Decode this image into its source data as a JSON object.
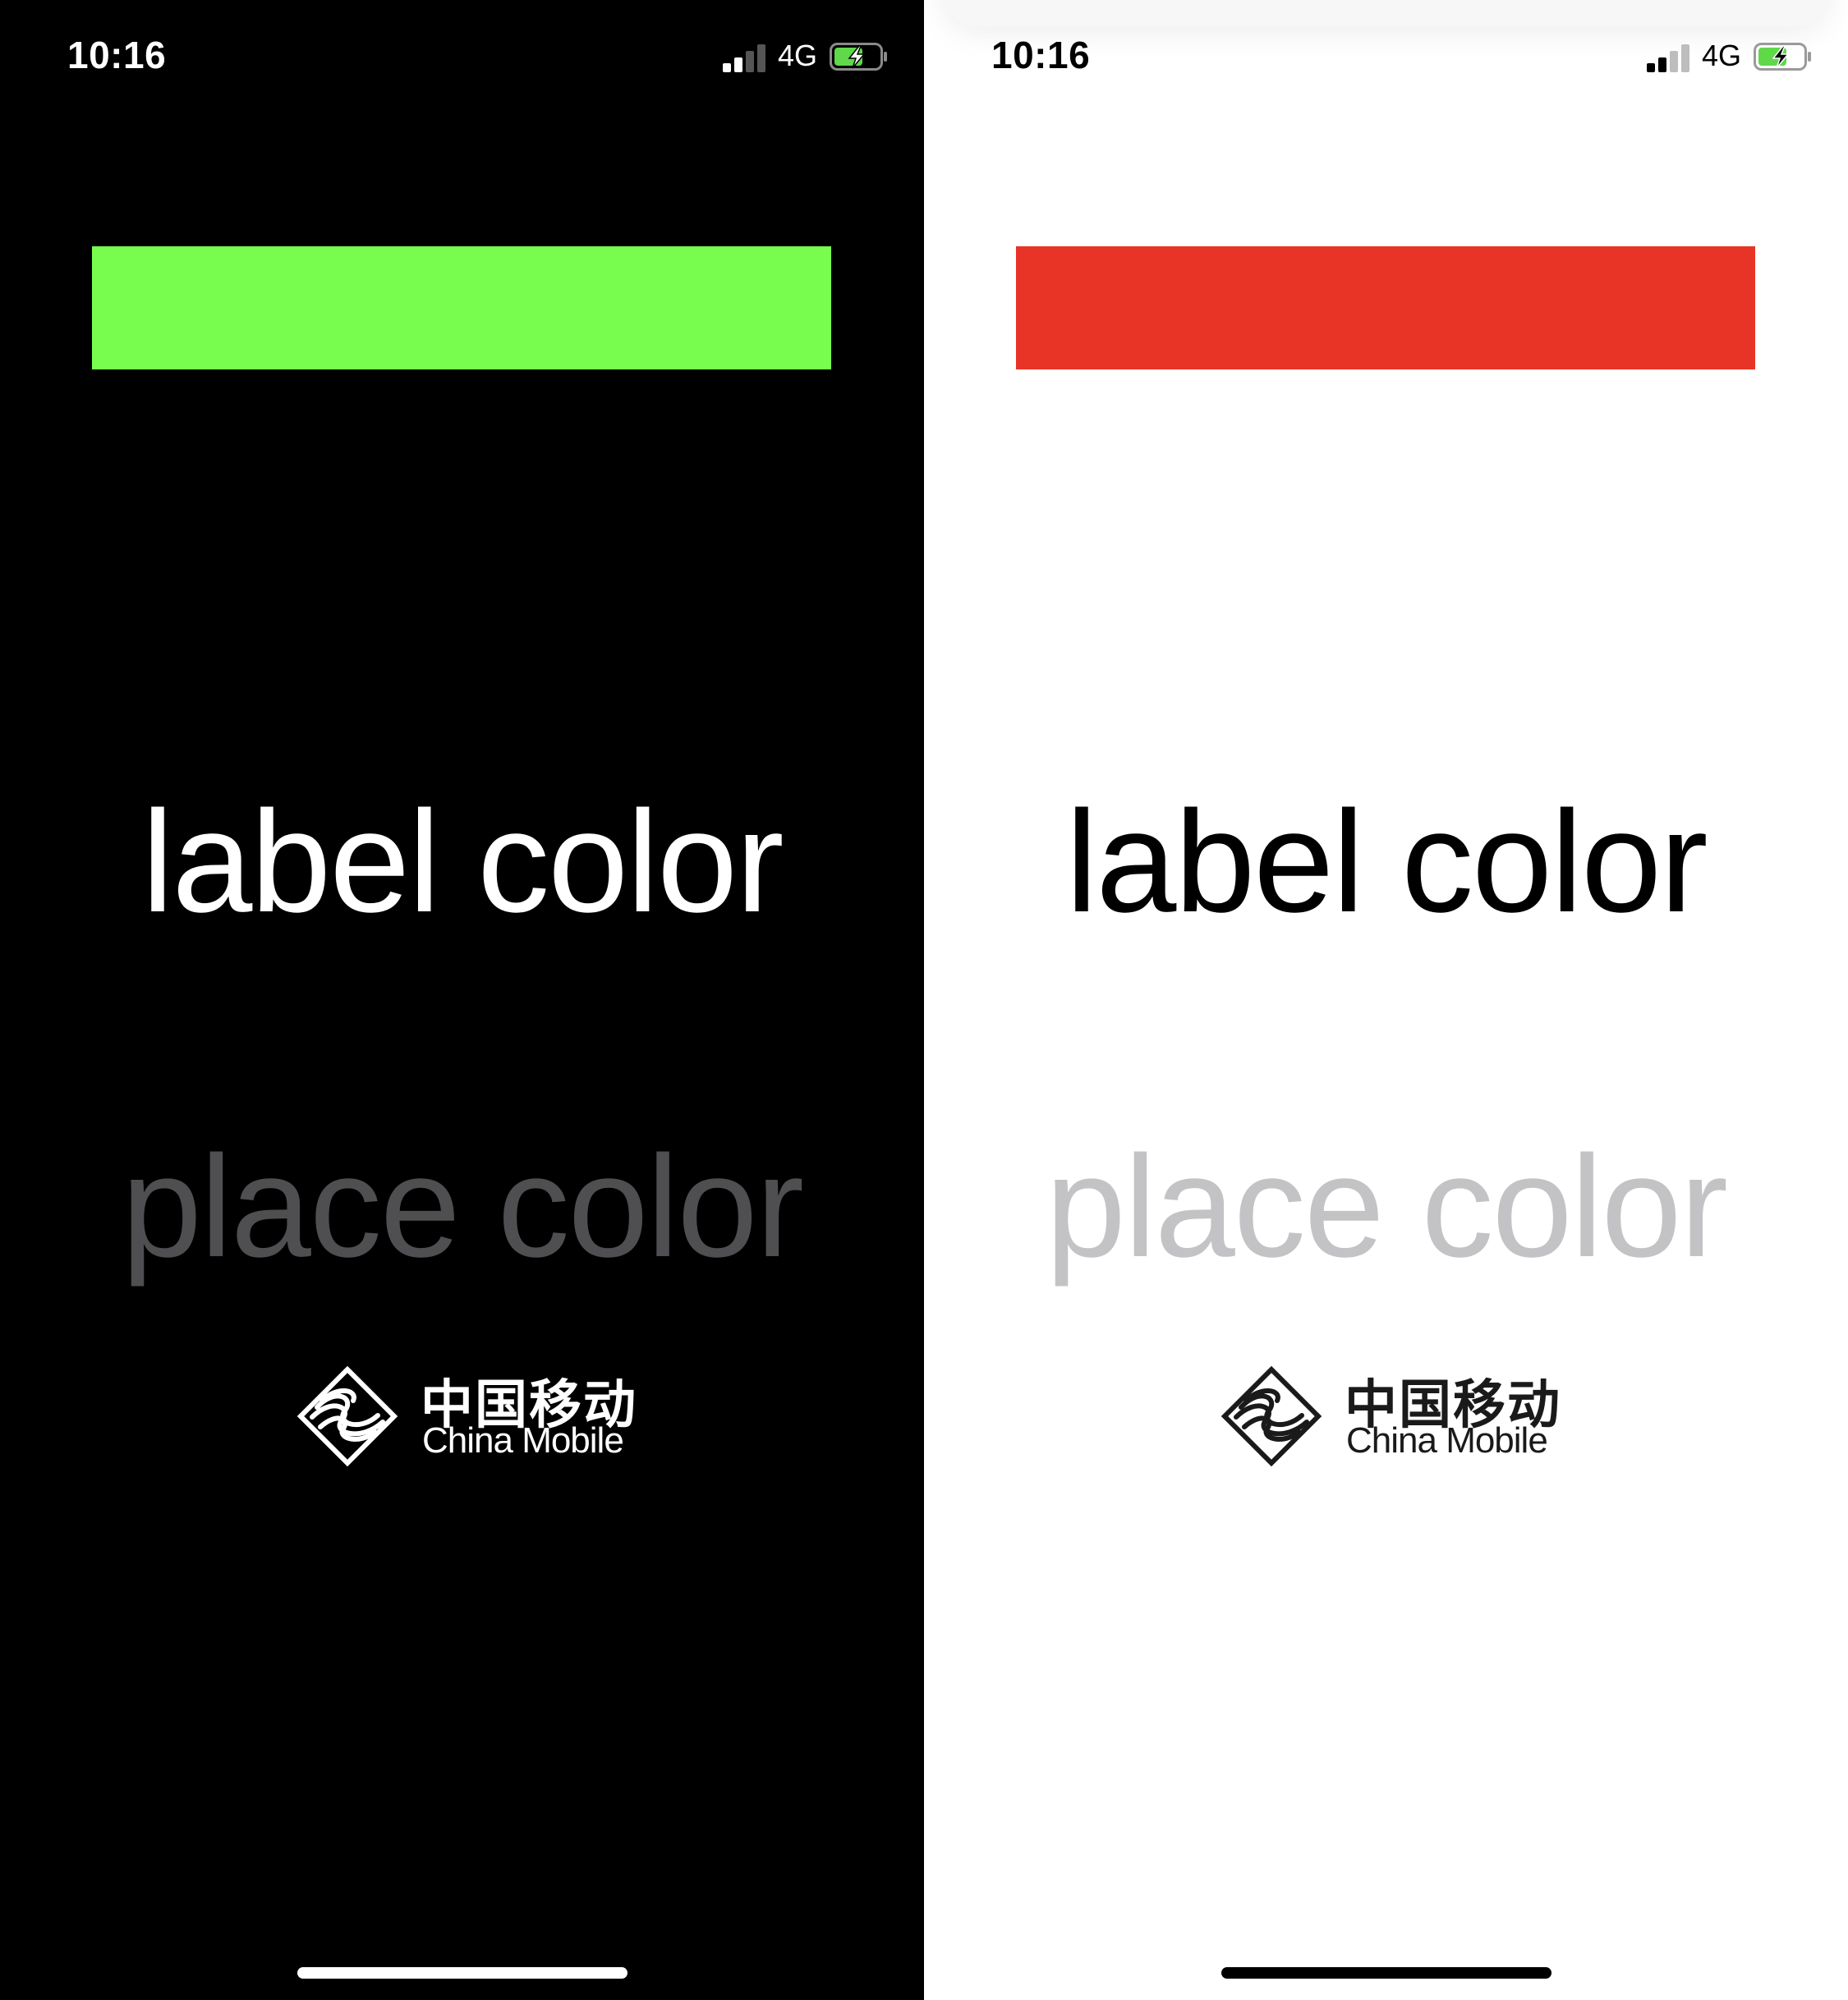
{
  "screens": [
    {
      "id": "dark",
      "status_bar": {
        "time": "10:16",
        "network": "4G",
        "battery_charging": true
      },
      "swatch_color": "#78fd4e",
      "label_text": "label color",
      "label_color": "#ffffff",
      "placeholder_text": "place color",
      "placeholder_color": "#4f4f52",
      "logo": {
        "chinese": "中国移动",
        "english": "China Mobile",
        "color": "#ffffff"
      },
      "home_indicator_color": "#ffffff"
    },
    {
      "id": "light",
      "status_bar": {
        "time": "10:16",
        "network": "4G",
        "battery_charging": true
      },
      "swatch_color": "#e83426",
      "label_text": "label color",
      "label_color": "#000000",
      "placeholder_text": "place color",
      "placeholder_color": "#c3c3c6",
      "logo": {
        "chinese": "中国移动",
        "english": "China Mobile",
        "color": "#1a1a1a"
      },
      "home_indicator_color": "#000000"
    }
  ],
  "colors": {
    "battery_fill": "#5fd84a",
    "signal_inactive_dark": "#555555",
    "signal_inactive_light": "#bdbdbd"
  }
}
